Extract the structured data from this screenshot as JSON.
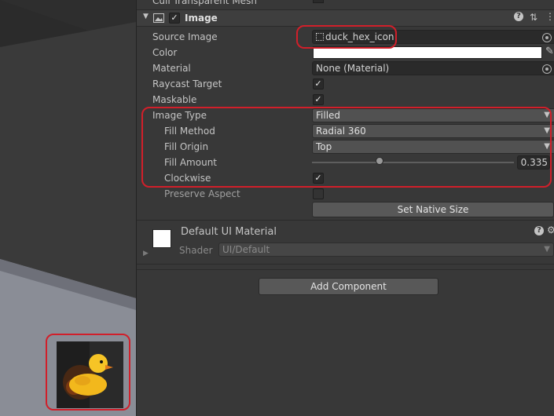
{
  "scene": {
    "thumbnail_alt": "duck hex icon preview"
  },
  "inspector": {
    "cut_row_label": "Cull Transparent Mesh",
    "component": {
      "title": "Image",
      "enabled": true
    },
    "rows": {
      "source_image": {
        "label": "Source Image",
        "value": "duck_hex_icon"
      },
      "color": {
        "label": "Color",
        "value": "#ffffff"
      },
      "material": {
        "label": "Material",
        "value": "None (Material)"
      },
      "raycast_target": {
        "label": "Raycast Target",
        "checked": true
      },
      "maskable": {
        "label": "Maskable",
        "checked": true
      },
      "image_type": {
        "label": "Image Type",
        "value": "Filled"
      },
      "fill_method": {
        "label": "Fill Method",
        "value": "Radial 360"
      },
      "fill_origin": {
        "label": "Fill Origin",
        "value": "Top"
      },
      "fill_amount": {
        "label": "Fill Amount",
        "value": "0.335",
        "level": 0.335
      },
      "clockwise": {
        "label": "Clockwise",
        "checked": true
      },
      "preserve_aspect": {
        "label": "Preserve Aspect",
        "checked": false
      }
    },
    "set_native_size_label": "Set Native Size",
    "material_section": {
      "title": "Default UI Material",
      "shader_label": "Shader",
      "shader_value": "UI/Default"
    },
    "add_component_label": "Add Component"
  },
  "colors": {
    "annotation": "#d11f2a",
    "panel_bg": "#383838",
    "scene_bg": "#2b2b2b"
  }
}
